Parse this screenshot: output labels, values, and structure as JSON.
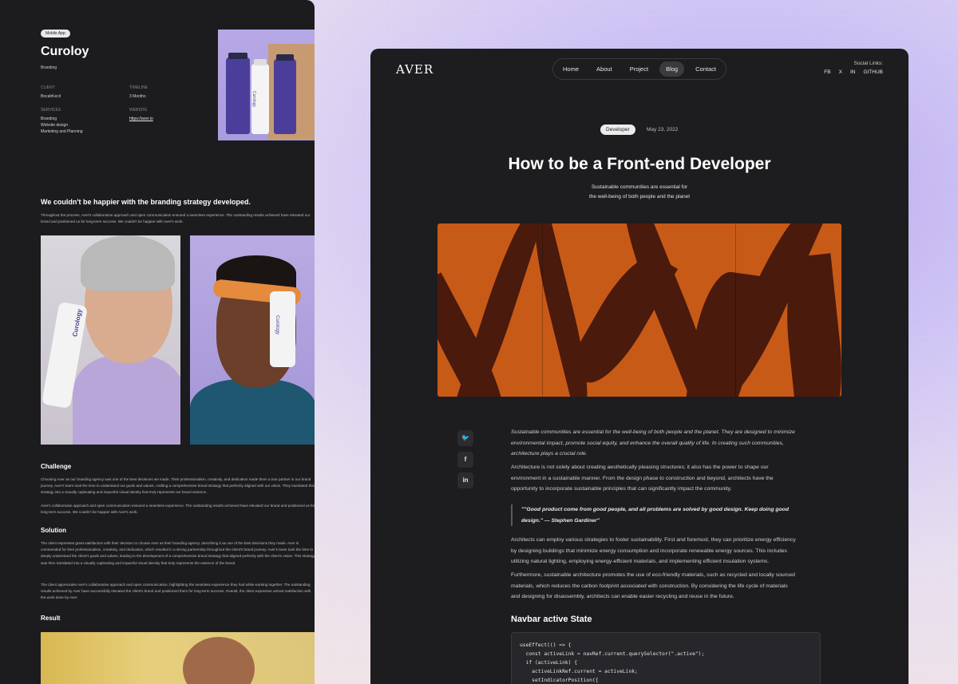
{
  "left_panel": {
    "tag": "Mobile App",
    "title": "Curoloy",
    "subtitle": "Branding",
    "meta": {
      "client_label": "CLIENT",
      "client_value": "BocahKecil",
      "timeline_label": "TIMELINE",
      "timeline_value": "3 Months",
      "services_label": "SERVICES",
      "services_values": [
        "Branding",
        "Website design",
        "Marketing and Planning"
      ],
      "website_label": "WEBSITE",
      "website_value": "https://aver.io"
    },
    "product_brand": "Curology",
    "quote_heading": "We couldn't be happier with the branding strategy developed.",
    "quote_text": "Throughout the process, Aver's collaborative approach and open communication ensured a seamless experience. The outstanding results achieved have elevated our brand and positioned us for long-term success. We couldn't be happier with Aver's work.",
    "challenge_heading": "Challenge",
    "challenge_text_1": "Choosing Aver as our branding agency was one of the best decisions we made. Their professionalism, creativity, and dedication made them a true partner in our brand journey. Aver's team took the time to understand our goals and values, crafting a comprehensive brand strategy that perfectly aligned with our vision. They translated this strategy into a visually captivating and impactful visual identity that truly represents our brand essence.",
    "challenge_text_2": "Aver's collaborative approach and open communication ensured a seamless experience. The outstanding results achieved have elevated our brand and positioned us for long-term success. We couldn't be happier with Aver's work.",
    "solution_heading": "Solution",
    "solution_text_1": "The client expresses great satisfaction with their decision to choose Aver as their branding agency, describing it as one of the best decisions they made. Aver is commended for their professionalism, creativity, and dedication, which resulted in a strong partnership throughout the client's brand journey. Aver's team took the time to deeply understand the client's goals and values, leading to the development of a comprehensive brand strategy that aligned perfectly with the client's vision. This strategy was then translated into a visually captivating and impactful visual identity that truly represents the essence of the brand.",
    "solution_text_2": "The client appreciates Aver's collaborative approach and open communication, highlighting the seamless experience they had while working together. The outstanding results achieved by Aver have successfully elevated the client's brand and positioned them for long-term success. Overall, the client expresses utmost satisfaction with the work done by Aver.",
    "result_heading": "Result"
  },
  "right_panel": {
    "logo": "AVER",
    "nav": [
      "Home",
      "About",
      "Project",
      "Blog",
      "Contact"
    ],
    "nav_active": "Blog",
    "social_label": "Social Links:",
    "social": [
      "FB",
      "X",
      "IN",
      "GITHUB"
    ],
    "badge": "Developer",
    "date": "May 23, 2022",
    "title": "How to be a Front-end Developer",
    "subtitle_line1": "Sustainable communities are essential for",
    "subtitle_line2": "the well-being of both people and the planet",
    "share_icons": [
      "twitter-icon",
      "facebook-icon",
      "linkedin-icon"
    ],
    "intro": "Sustainable communities are essential for the well-being of both people and the planet. They are designed to minimize environmental impact, promote social equity, and enhance the overall quality of life. In creating such communities, architecture plays a crucial role.",
    "para1": "Architecture is not solely about creating aesthetically pleasing structures; it also has the power to shape our environment in a sustainable manner. From the design phase to construction and beyond, architects have the opportunity to incorporate sustainable principles that can significantly impact the community.",
    "quote": "\"\"Good product come from good people, and all problems are solved by good design. Keep doing good design.\" — Stephen Gardiner\"",
    "para2": "Architects can employ various strategies to foster sustainability. First and foremost, they can prioritize energy efficiency by designing buildings that minimize energy consumption and incorporate renewable energy sources. This includes utilizing natural lighting, employing energy-efficient materials, and implementing efficient insulation systems.",
    "para3": "Furthermore, sustainable architecture promotes the use of eco-friendly materials, such as recycled and locally sourced materials, which reduces the carbon footprint associated with construction. By considering the life cycle of materials and designing for disassembly, architects can enable easier recycling and reuse in the future.",
    "section_heading": "Navbar active State",
    "code": [
      "useEffect(() => {",
      "  const activeLink = navRef.current.querySelector(\".active\");",
      "  if (activeLink) {",
      "    activeLinkRef.current = activeLink;",
      "    setIndicatorPosition({"
    ]
  },
  "colors": {
    "accent_orange": "#c85a18",
    "panel_bg": "#1d1d1f",
    "leaf_dark": "#4a1a0c",
    "bottle_purple": "#4b3e9b"
  }
}
